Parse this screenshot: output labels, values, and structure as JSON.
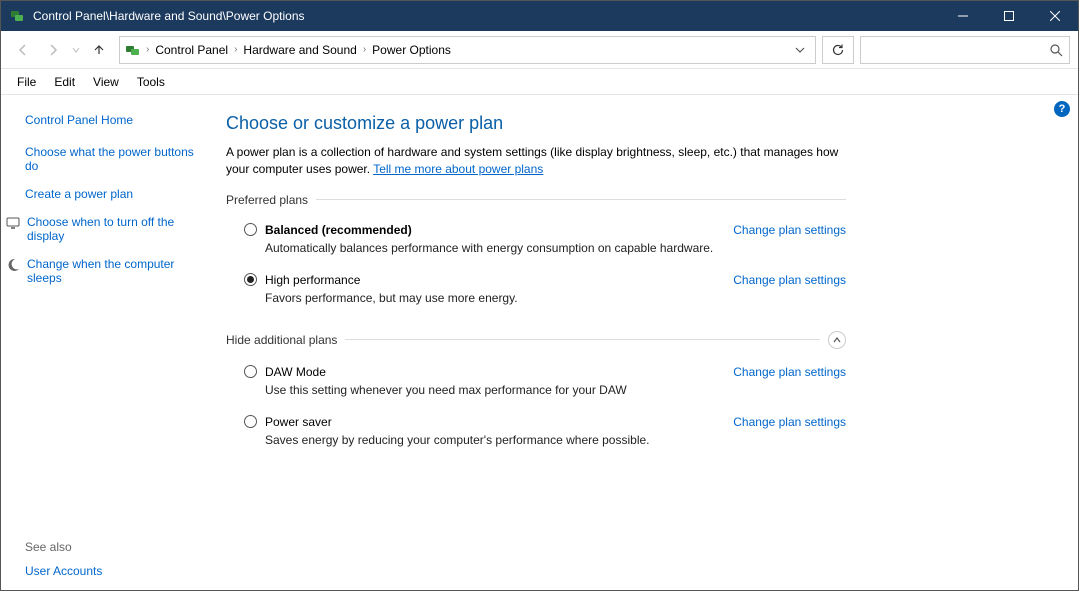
{
  "window": {
    "title": "Control Panel\\Hardware and Sound\\Power Options"
  },
  "breadcrumb": {
    "items": [
      "Control Panel",
      "Hardware and Sound",
      "Power Options"
    ]
  },
  "search": {
    "placeholder": ""
  },
  "menu": {
    "file": "File",
    "edit": "Edit",
    "view": "View",
    "tools": "Tools"
  },
  "sidebar": {
    "home": "Control Panel Home",
    "links": [
      {
        "label": "Choose what the power buttons do",
        "icon": false
      },
      {
        "label": "Create a power plan",
        "icon": false
      },
      {
        "label": "Choose when to turn off the display",
        "icon": true
      },
      {
        "label": "Change when the computer sleeps",
        "icon": true
      }
    ],
    "see_also_label": "See also",
    "see_also_links": [
      "User Accounts"
    ]
  },
  "main": {
    "heading": "Choose or customize a power plan",
    "description_pre": "A power plan is a collection of hardware and system settings (like display brightness, sleep, etc.) that manages how your computer uses power. ",
    "description_link": "Tell me more about power plans",
    "preferred_label": "Preferred plans",
    "hide_label": "Hide additional plans",
    "change_link": "Change plan settings",
    "plans_preferred": [
      {
        "name": "Balanced (recommended)",
        "desc": "Automatically balances performance with energy consumption on capable hardware.",
        "selected": false,
        "bold": true
      },
      {
        "name": "High performance",
        "desc": "Favors performance, but may use more energy.",
        "selected": true,
        "bold": false
      }
    ],
    "plans_additional": [
      {
        "name": "DAW Mode",
        "desc": "Use this setting whenever you need max performance for your DAW",
        "selected": false,
        "bold": false
      },
      {
        "name": "Power saver",
        "desc": "Saves energy by reducing your computer's performance where possible.",
        "selected": false,
        "bold": false
      }
    ]
  }
}
